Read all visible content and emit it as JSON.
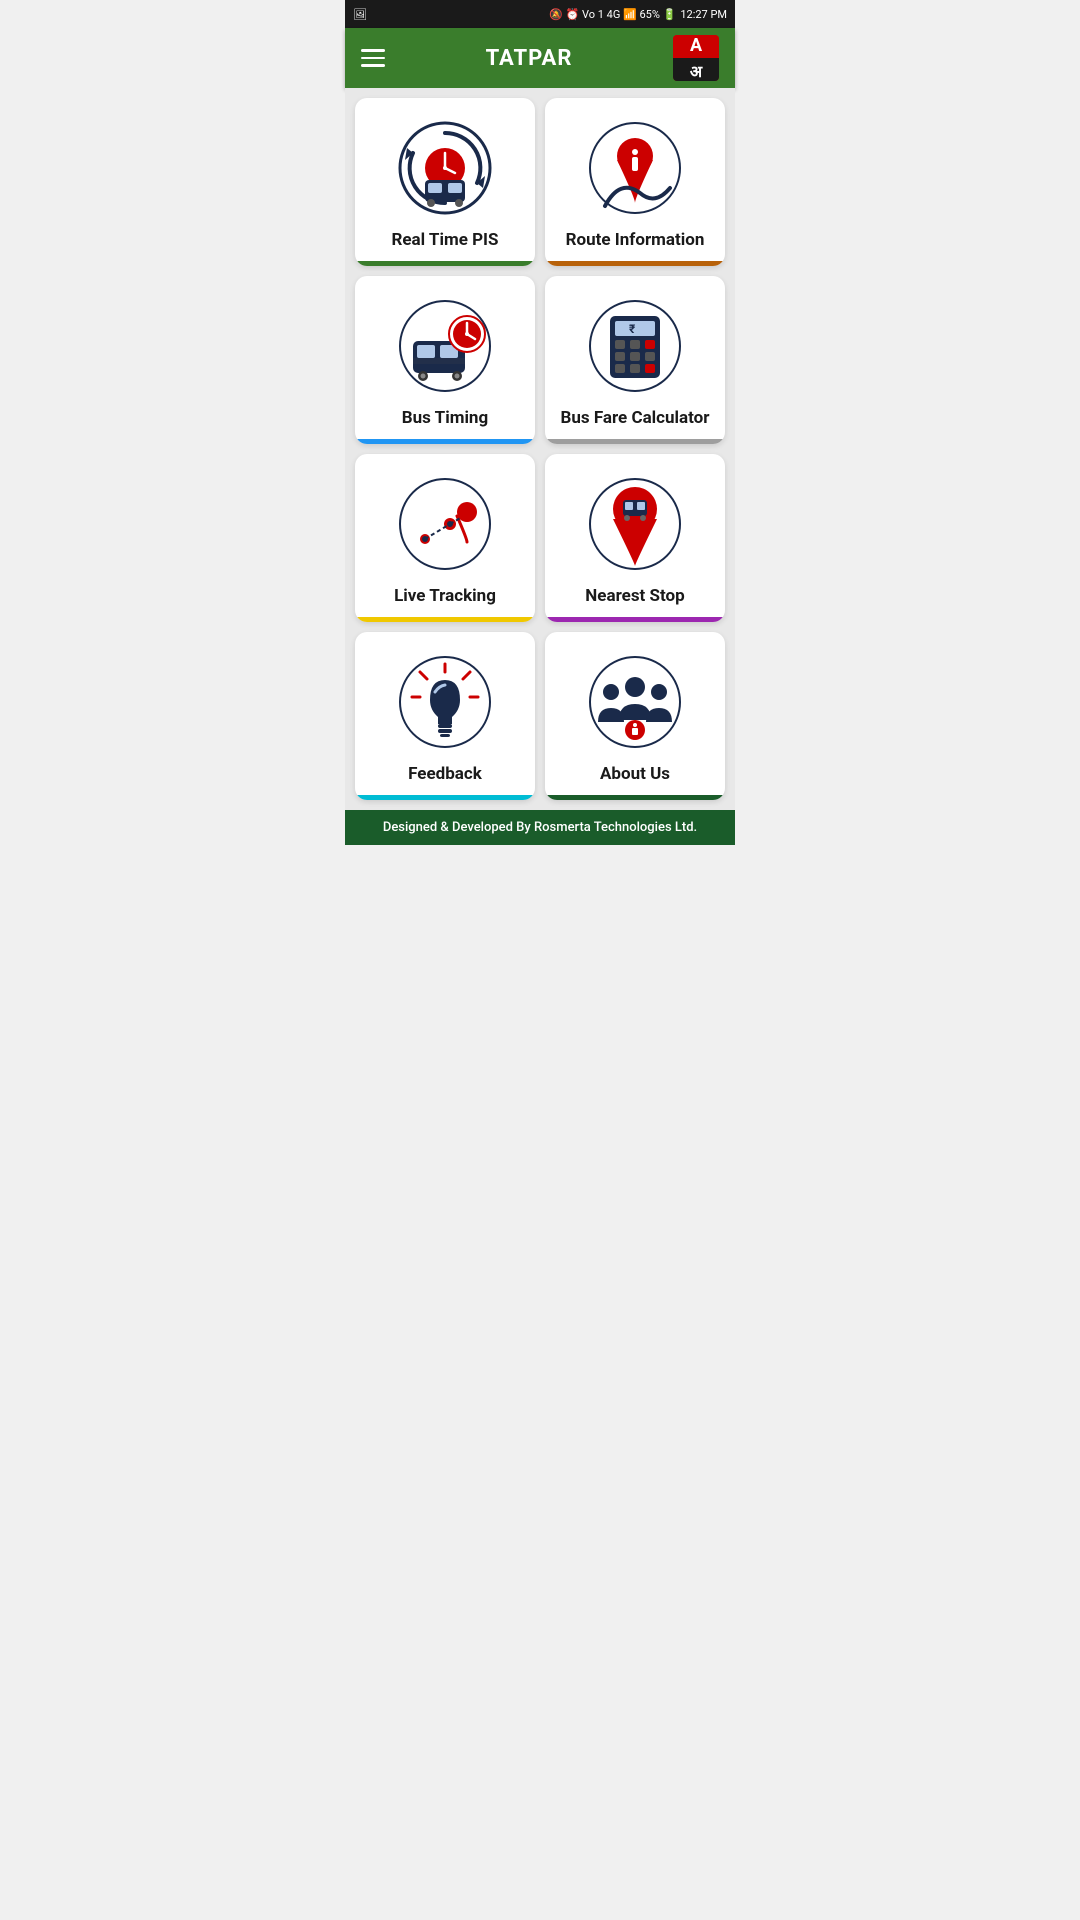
{
  "status_bar": {
    "time": "12:27 PM",
    "battery": "65%",
    "signal": "4G"
  },
  "app_bar": {
    "title": "TATPAR",
    "menu_label": "Menu",
    "lang_top": "A",
    "lang_bottom": "अ"
  },
  "cards": [
    {
      "id": "real-time-pis",
      "label": "Real Time PIS",
      "border_color": "#3a7d2c"
    },
    {
      "id": "route-information",
      "label": "Route Information",
      "border_color": "#b8620a"
    },
    {
      "id": "bus-timing",
      "label": "Bus Timing",
      "border_color": "#2196f3"
    },
    {
      "id": "bus-fare-calculator",
      "label": "Bus Fare Calculator",
      "border_color": "#9e9e9e"
    },
    {
      "id": "live-tracking",
      "label": "Live Tracking",
      "border_color": "#f0c800"
    },
    {
      "id": "nearest-stop",
      "label": "Nearest Stop",
      "border_color": "#9c27b0"
    },
    {
      "id": "feedback",
      "label": "Feedback",
      "border_color": "#00bcd4"
    },
    {
      "id": "about-us",
      "label": "About Us",
      "border_color": "#1a5c2a"
    }
  ],
  "footer": {
    "text": "Designed & Developed By Rosmerta Technologies Ltd."
  }
}
